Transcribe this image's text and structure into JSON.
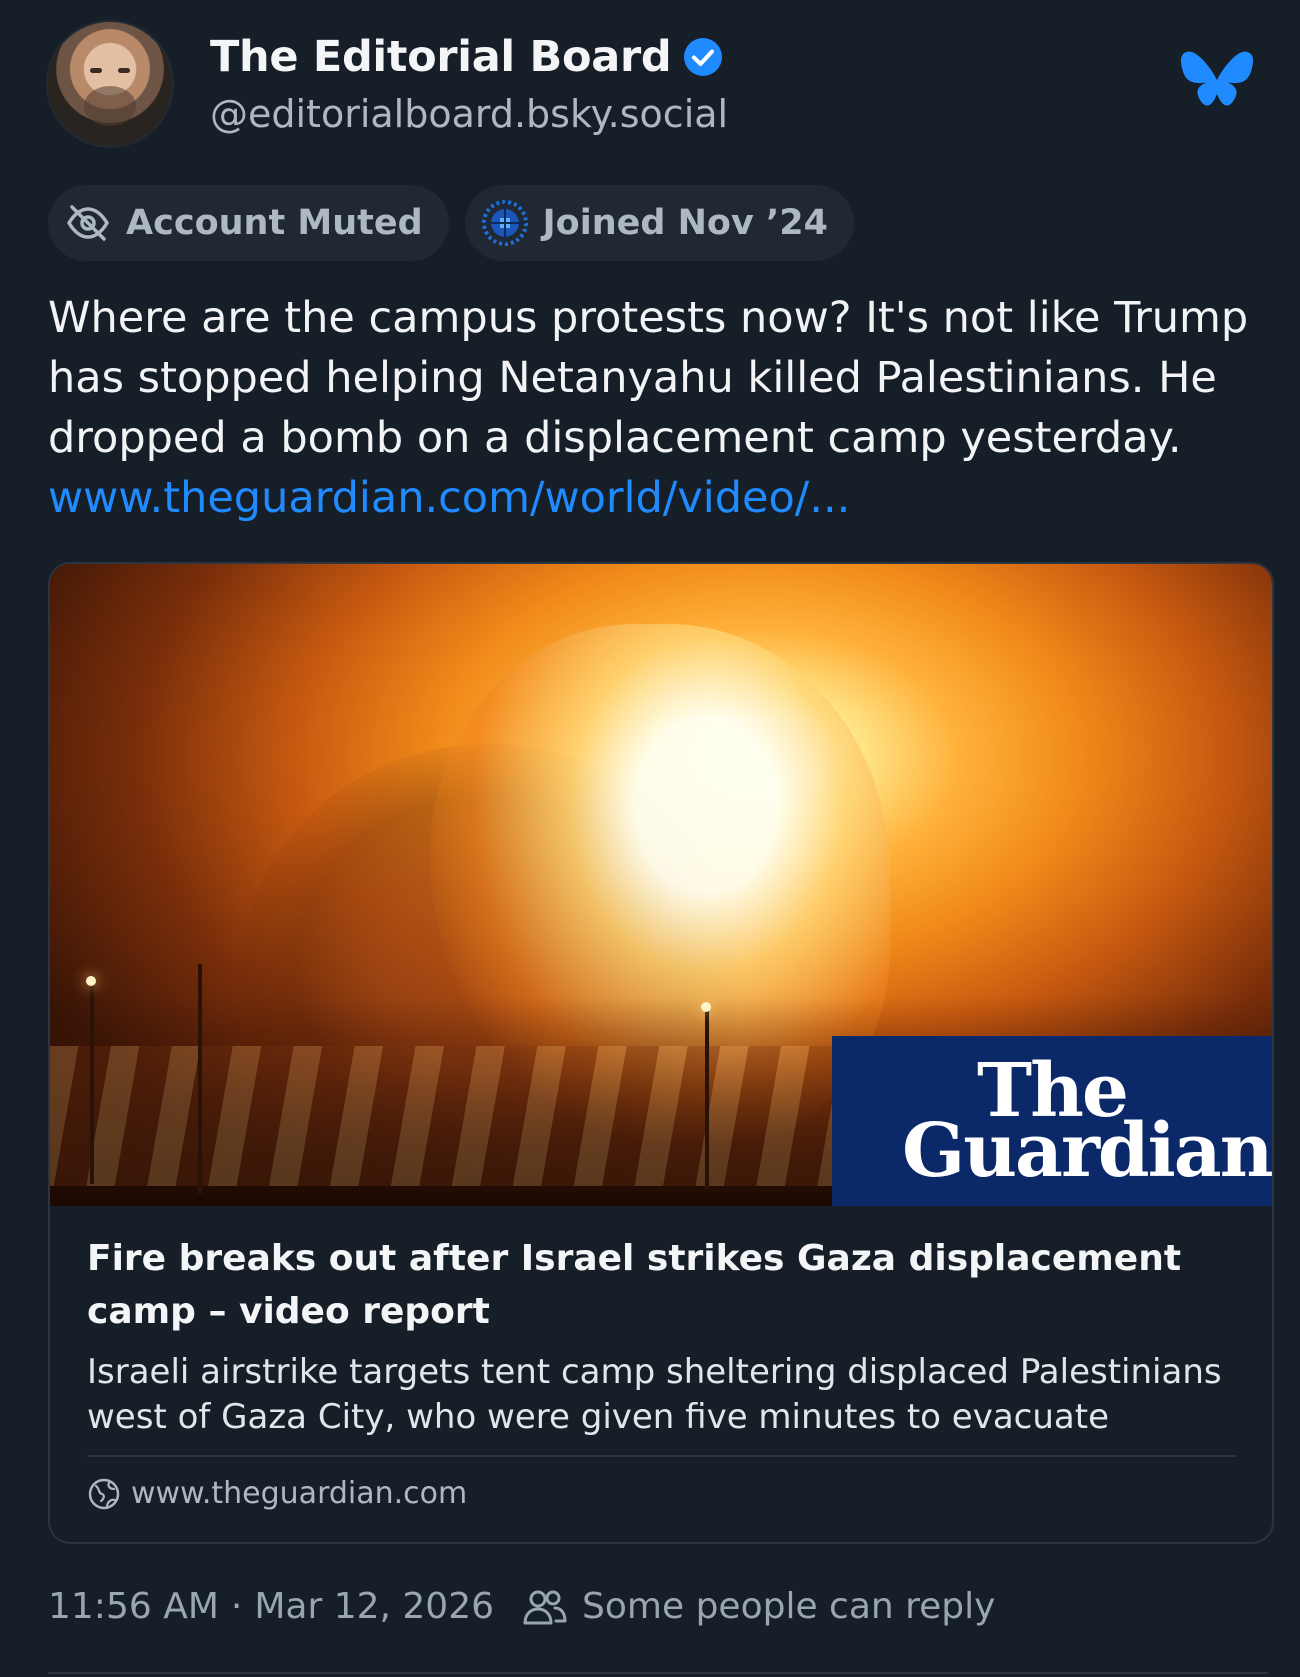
{
  "author": {
    "display_name": "The Editorial Board",
    "handle": "@editorialboard.bsky.social",
    "verified": true
  },
  "badges": {
    "muted_label": "Account Muted",
    "joined_label": "Joined Nov ’24"
  },
  "post": {
    "text": "Where are the campus protests now? It's not like Trump has stopped helping Netanyahu killed Palestinians. He dropped a bomb on a displacement camp yesterday.",
    "link_text": "www.theguardian.com/world/video/..."
  },
  "embed": {
    "thumbnail_logo": "The Guardian",
    "title": "Fire breaks out after Israel strikes Gaza displacement camp – video report",
    "description": "Israeli airstrike targets tent camp sheltering displaced Palestinians west of Gaza City, who were given five minutes to evacuate",
    "domain": "www.theguardian.com"
  },
  "meta": {
    "time": "11:56 AM",
    "separator": "·",
    "date": "Mar 12, 2026",
    "reply_setting": "Some people can reply"
  },
  "icons": {
    "verified": "verified-check-icon",
    "muted": "eye-slash-icon",
    "joined": "starter-badge-icon",
    "logo": "bluesky-butterfly-icon",
    "domain": "globe-icon",
    "reply": "people-icon"
  },
  "colors": {
    "background": "#161e27",
    "accent": "#1f8bff",
    "guardian_blue": "#0b2869"
  }
}
